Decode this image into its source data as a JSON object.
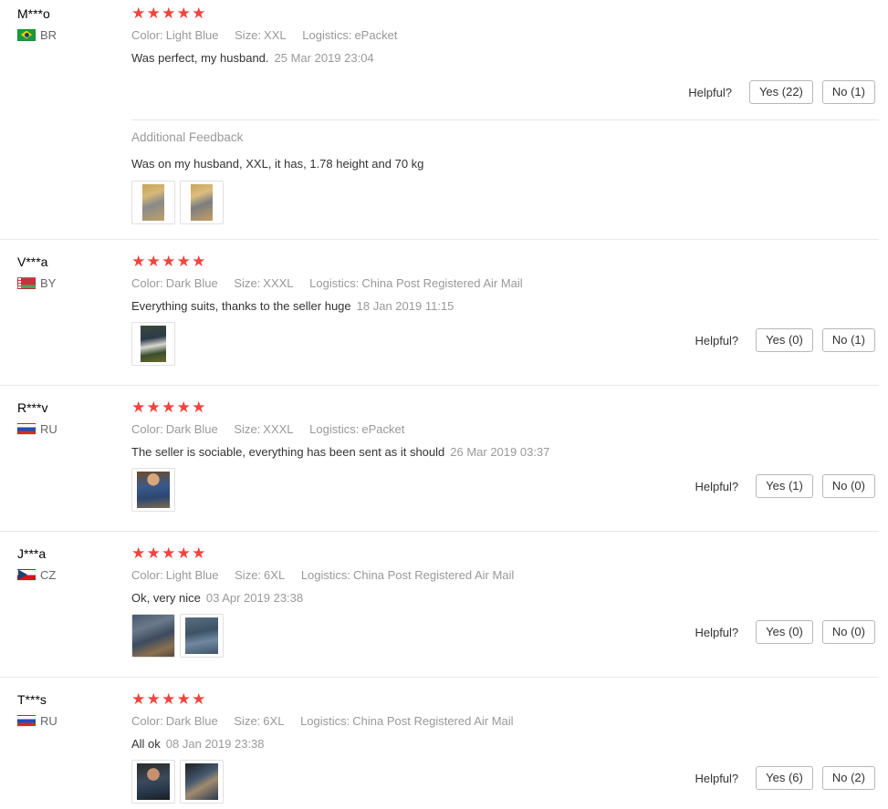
{
  "reviews": [
    {
      "user": "M***o",
      "country": "BR",
      "flag": "br",
      "stars": 5,
      "color_label": "Color:",
      "color": "Light Blue",
      "size_label": "Size:",
      "size": "XXL",
      "logistics_label": "Logistics:",
      "logistics": "ePacket",
      "comment": "Was perfect, my husband.",
      "date": "25 Mar 2019 23:04",
      "helpful_label": "Helpful?",
      "yes_label": "Yes (22)",
      "no_label": "No (1)",
      "additional_title": "Additional Feedback",
      "additional_text": "Was on my husband, XXL, it has, 1.78 height and 70 kg",
      "photos": [
        "photo-a",
        "photo-b"
      ]
    },
    {
      "user": "V***a",
      "country": "BY",
      "flag": "by",
      "stars": 5,
      "color_label": "Color:",
      "color": "Dark Blue",
      "size_label": "Size:",
      "size": "XXXL",
      "logistics_label": "Logistics:",
      "logistics": "China Post Registered Air Mail",
      "comment": "Everything suits, thanks to the seller huge",
      "date": "18 Jan 2019 11:15",
      "helpful_label": "Helpful?",
      "yes_label": "Yes (0)",
      "no_label": "No (1)",
      "photos": [
        "photo-a"
      ]
    },
    {
      "user": "R***v",
      "country": "RU",
      "flag": "ru",
      "stars": 5,
      "color_label": "Color:",
      "color": "Dark Blue",
      "size_label": "Size:",
      "size": "XXXL",
      "logistics_label": "Logistics:",
      "logistics": "ePacket",
      "comment": "The seller is sociable, everything has been sent as it should",
      "date": "26 Mar 2019 03:37",
      "helpful_label": "Helpful?",
      "yes_label": "Yes (1)",
      "no_label": "No (0)",
      "photos": [
        "photo-a"
      ]
    },
    {
      "user": "J***a",
      "country": "CZ",
      "flag": "cz",
      "stars": 5,
      "color_label": "Color:",
      "color": "Light Blue",
      "size_label": "Size:",
      "size": "6XL",
      "logistics_label": "Logistics:",
      "logistics": "China Post Registered Air Mail",
      "comment": "Ok, very nice",
      "date": "03 Apr 2019 23:38",
      "helpful_label": "Helpful?",
      "yes_label": "Yes (0)",
      "no_label": "No (0)",
      "photos": [
        "photo-a",
        "photo-b"
      ]
    },
    {
      "user": "T***s",
      "country": "RU",
      "flag": "ru",
      "stars": 5,
      "color_label": "Color:",
      "color": "Dark Blue",
      "size_label": "Size:",
      "size": "6XL",
      "logistics_label": "Logistics:",
      "logistics": "China Post Registered Air Mail",
      "comment": "All ok",
      "date": "08 Jan 2019 23:38",
      "helpful_label": "Helpful?",
      "yes_label": "Yes (6)",
      "no_label": "No (2)",
      "photos": [
        "photo-a",
        "photo-b"
      ]
    }
  ],
  "colors": {
    "star": "#f3433d",
    "muted_text": "#999999",
    "body_text": "#333333",
    "divider": "#e8e8e8",
    "button_border": "#b8b8b8"
  },
  "icons": {
    "star": "star-icon",
    "flag": "flag-icon"
  }
}
